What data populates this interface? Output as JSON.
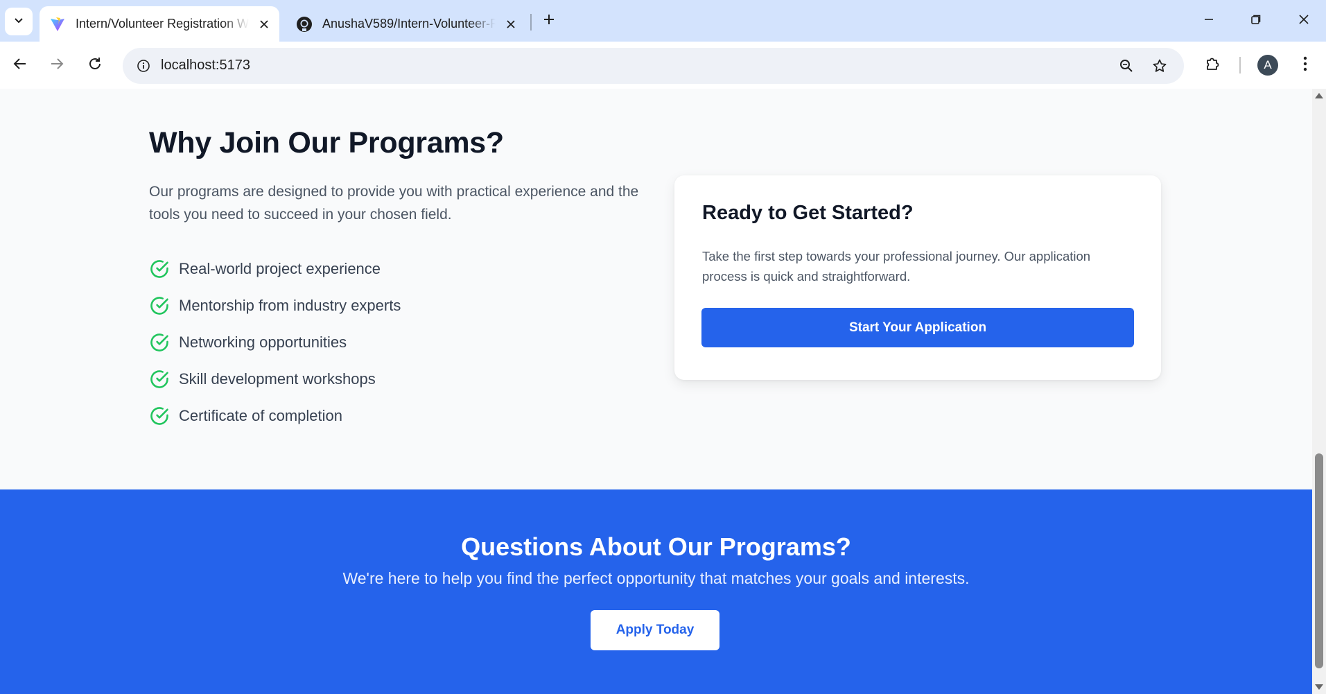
{
  "browser": {
    "tabs": [
      {
        "title": "Intern/Volunteer Registration W",
        "favicon": "vite-logo-icon",
        "active": true
      },
      {
        "title": "AnushaV589/Intern-Volunteer-R",
        "favicon": "github-icon",
        "active": false
      }
    ],
    "address": "localhost:5173",
    "profile_initial": "A"
  },
  "why_join": {
    "title": "Why Join Our Programs?",
    "description": "Our programs are designed to provide you with practical experience and the tools you need to succeed in your chosen field.",
    "benefits": [
      "Real-world project experience",
      "Mentorship from industry experts",
      "Networking opportunities",
      "Skill development workshops",
      "Certificate of completion"
    ]
  },
  "get_started": {
    "title": "Ready to Get Started?",
    "text": "Take the first step towards your professional journey. Our application process is quick and straightforward.",
    "button_label": "Start Your Application"
  },
  "questions": {
    "title": "Questions About Our Programs?",
    "text": "We're here to help you find the perfect opportunity that matches your goals and interests.",
    "button_label": "Apply Today"
  },
  "colors": {
    "primary": "#2563eb",
    "check": "#22c55e",
    "heading": "#111827",
    "tabstrip": "#d3e3fd"
  }
}
